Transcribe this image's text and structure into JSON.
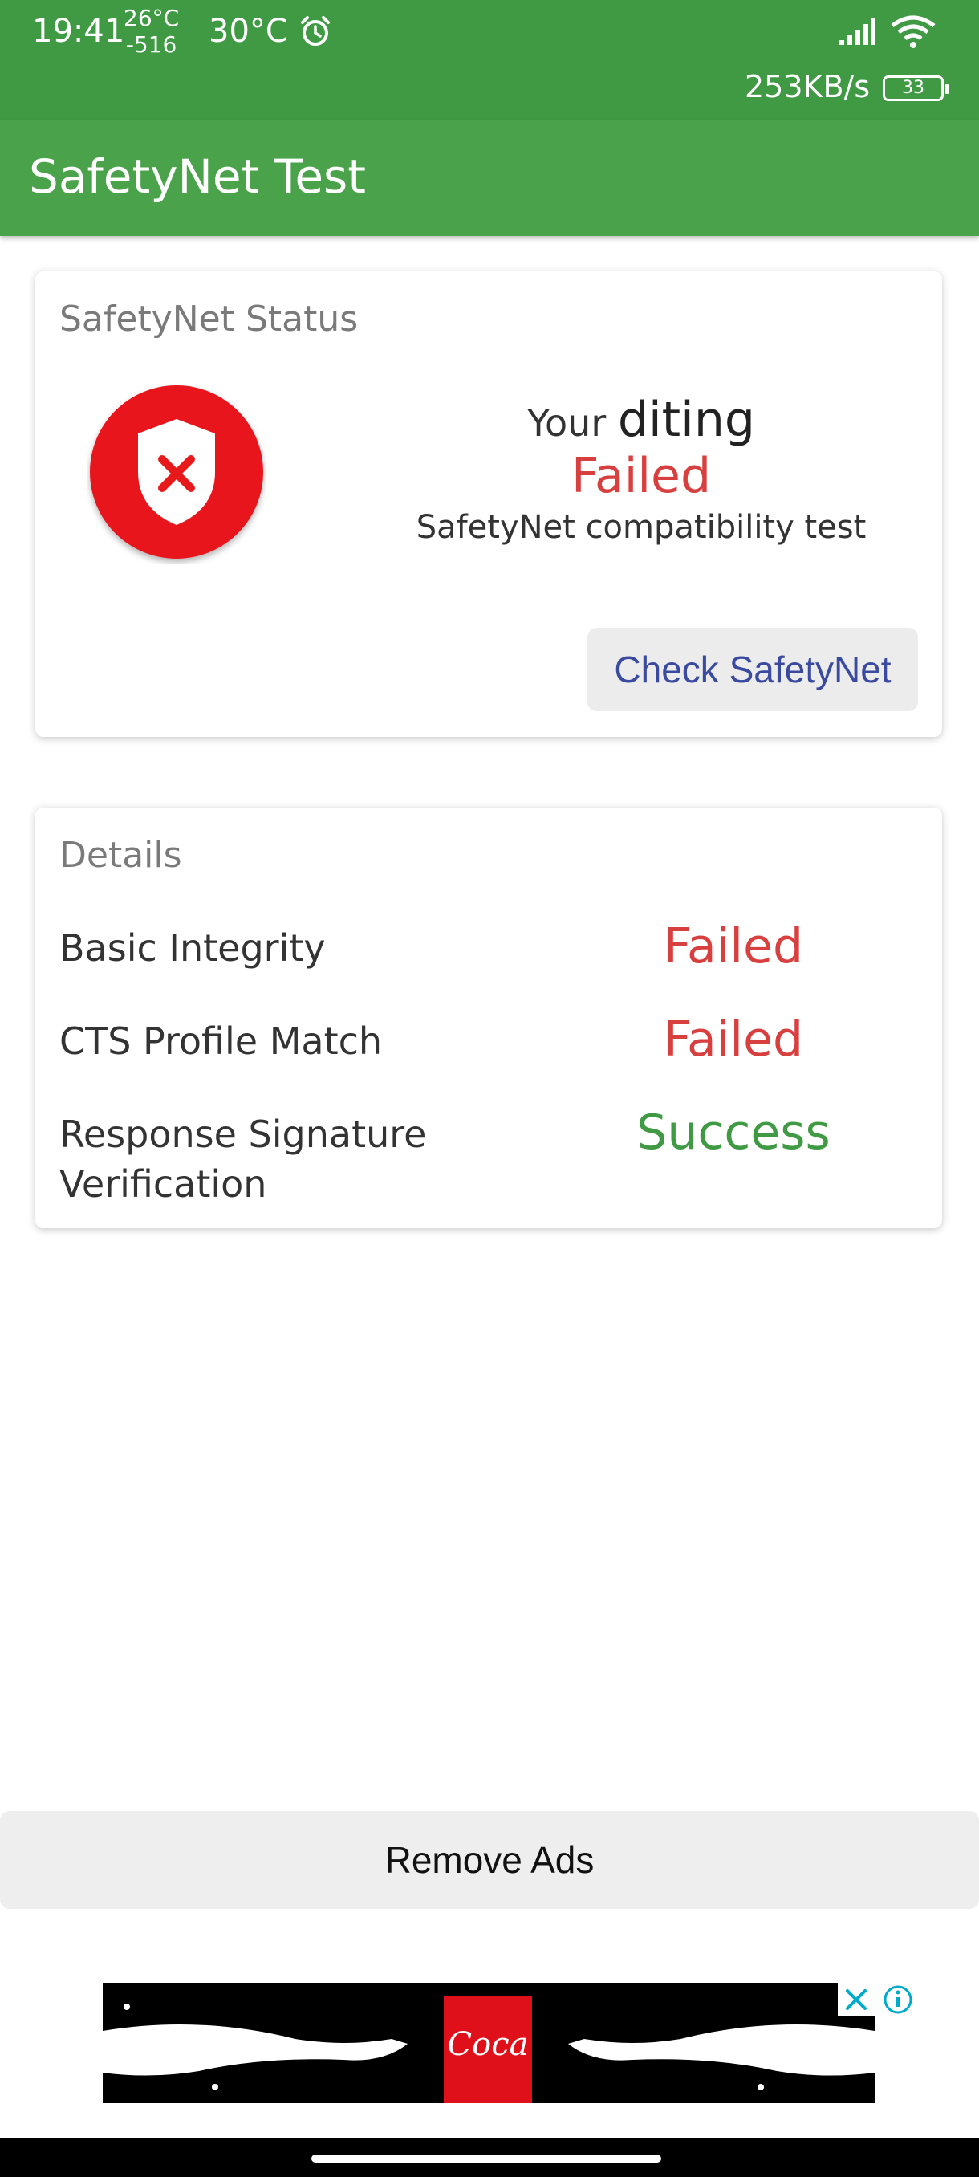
{
  "status_bar": {
    "time": "19:41",
    "temp_high": "26°C",
    "temp_low": "-516",
    "temp_current": "30°C",
    "net_speed": "253KB/s",
    "battery_level": "33",
    "icons": [
      "alarm-icon",
      "signal-icon",
      "wifi-icon",
      "battery-icon"
    ]
  },
  "app_bar": {
    "title": "SafetyNet Test"
  },
  "status_card": {
    "title": "SafetyNet Status",
    "line_prefix": "Your",
    "line_device": "diting",
    "result": "Failed",
    "subtitle": "SafetyNet compatibility test",
    "check_button": "Check SafetyNet",
    "icon": "shield-fail-icon",
    "result_color": "#d84040"
  },
  "details_card": {
    "title": "Details",
    "rows": [
      {
        "label": "Basic Integrity",
        "value": "Failed",
        "status": "fail"
      },
      {
        "label": "CTS Profile Match",
        "value": "Failed",
        "status": "fail"
      },
      {
        "label": "Response Signature Verification",
        "value": "Success",
        "status": "success"
      }
    ]
  },
  "remove_ads": {
    "label": "Remove Ads"
  },
  "colors": {
    "primary": "#4aa34a",
    "status_bar": "#3f9a43",
    "fail": "#d84040",
    "success": "#3f9a43",
    "button_text": "#3a4aa0"
  }
}
